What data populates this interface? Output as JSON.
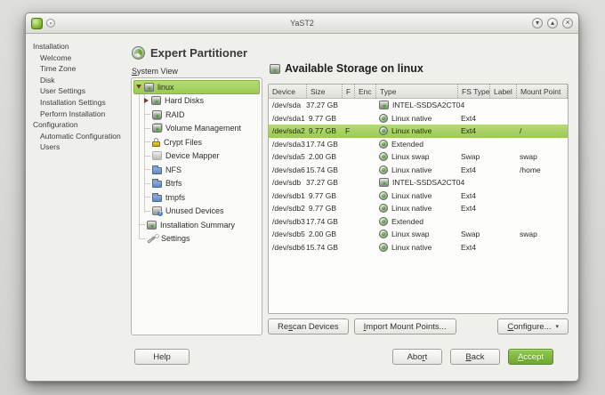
{
  "window": {
    "title": "YaST2",
    "controls": {
      "minimize": "minimize",
      "maximize": "maximize",
      "close": "close"
    }
  },
  "sidebar": {
    "items": [
      {
        "label": "Installation",
        "level": 0
      },
      {
        "label": "Welcome",
        "level": 1
      },
      {
        "label": "Time Zone",
        "level": 1
      },
      {
        "label": "Disk",
        "level": 1
      },
      {
        "label": "User Settings",
        "level": 1
      },
      {
        "label": "Installation Settings",
        "level": 1
      },
      {
        "label": "Perform Installation",
        "level": 1
      },
      {
        "label": "Configuration",
        "level": 0
      },
      {
        "label": "Automatic Configuration",
        "level": 1
      },
      {
        "label": "Users",
        "level": 1
      }
    ]
  },
  "main": {
    "title": "Expert Partitioner",
    "system_view": {
      "label": {
        "pre": "",
        "key": "S",
        "post": "ystem View"
      },
      "tree": [
        {
          "label": "linux",
          "icon": "hdd",
          "level": 0,
          "expander": "open",
          "selected": true
        },
        {
          "label": "Hard Disks",
          "icon": "hdd",
          "level": 1,
          "expander": "closed"
        },
        {
          "label": "RAID",
          "icon": "raid",
          "level": 1
        },
        {
          "label": "Volume Management",
          "icon": "volume",
          "level": 1
        },
        {
          "label": "Crypt Files",
          "icon": "lock",
          "level": 1
        },
        {
          "label": "Device Mapper",
          "icon": "mapper",
          "level": 1
        },
        {
          "label": "NFS",
          "icon": "folder",
          "level": 1
        },
        {
          "label": "Btrfs",
          "icon": "folder",
          "level": 1
        },
        {
          "label": "tmpfs",
          "icon": "folder",
          "level": 1
        },
        {
          "label": "Unused Devices",
          "icon": "unused",
          "level": 1
        },
        {
          "label": "Installation Summary",
          "icon": "summary",
          "level": 0.5
        },
        {
          "label": "Settings",
          "icon": "wand",
          "level": 0.5
        }
      ]
    },
    "storage": {
      "title": "Available Storage on linux",
      "table": {
        "columns": [
          "Device",
          "Size",
          "F",
          "Enc",
          "Type",
          "FS Type",
          "Label",
          "Mount Point"
        ],
        "rows": [
          {
            "device": "/dev/sda",
            "size": "37.27 GB",
            "f": "",
            "enc": "",
            "type": "INTEL-SSDSA2CT04",
            "icon": "hdd",
            "fs_type": "",
            "label": "",
            "mount": "",
            "selected": false
          },
          {
            "device": "/dev/sda1",
            "size": "9.77 GB",
            "f": "",
            "enc": "",
            "type": "Linux native",
            "icon": "partition",
            "fs_type": "Ext4",
            "label": "",
            "mount": "",
            "selected": false
          },
          {
            "device": "/dev/sda2",
            "size": "9.77 GB",
            "f": "F",
            "enc": "",
            "type": "Linux native",
            "icon": "partition",
            "fs_type": "Ext4",
            "label": "",
            "mount": "/",
            "selected": true
          },
          {
            "device": "/dev/sda3",
            "size": "17.74 GB",
            "f": "",
            "enc": "",
            "type": "Extended",
            "icon": "partition",
            "fs_type": "",
            "label": "",
            "mount": "",
            "selected": false
          },
          {
            "device": "/dev/sda5",
            "size": "2.00 GB",
            "f": "",
            "enc": "",
            "type": "Linux swap",
            "icon": "partition",
            "fs_type": "Swap",
            "label": "",
            "mount": "swap",
            "selected": false
          },
          {
            "device": "/dev/sda6",
            "size": "15.74 GB",
            "f": "",
            "enc": "",
            "type": "Linux native",
            "icon": "partition",
            "fs_type": "Ext4",
            "label": "",
            "mount": "/home",
            "selected": false
          },
          {
            "device": "/dev/sdb",
            "size": "37.27 GB",
            "f": "",
            "enc": "",
            "type": "INTEL-SSDSA2CT04",
            "icon": "hdd",
            "fs_type": "",
            "label": "",
            "mount": "",
            "selected": false
          },
          {
            "device": "/dev/sdb1",
            "size": "9.77 GB",
            "f": "",
            "enc": "",
            "type": "Linux native",
            "icon": "partition",
            "fs_type": "Ext4",
            "label": "",
            "mount": "",
            "selected": false
          },
          {
            "device": "/dev/sdb2",
            "size": "9.77 GB",
            "f": "",
            "enc": "",
            "type": "Linux native",
            "icon": "partition",
            "fs_type": "Ext4",
            "label": "",
            "mount": "",
            "selected": false
          },
          {
            "device": "/dev/sdb3",
            "size": "17.74 GB",
            "f": "",
            "enc": "",
            "type": "Extended",
            "icon": "partition",
            "fs_type": "",
            "label": "",
            "mount": "",
            "selected": false
          },
          {
            "device": "/dev/sdb5",
            "size": "2.00 GB",
            "f": "",
            "enc": "",
            "type": "Linux swap",
            "icon": "partition",
            "fs_type": "Swap",
            "label": "",
            "mount": "swap",
            "selected": false
          },
          {
            "device": "/dev/sdb6",
            "size": "15.74 GB",
            "f": "",
            "enc": "",
            "type": "Linux native",
            "icon": "partition",
            "fs_type": "Ext4",
            "label": "",
            "mount": "",
            "selected": false
          }
        ]
      },
      "buttons": {
        "rescan": {
          "pre": "Re",
          "key": "s",
          "post": "can Devices"
        },
        "import": {
          "pre": "",
          "key": "I",
          "post": "mport Mount Points..."
        },
        "configure": {
          "pre": "",
          "key": "C",
          "post": "onfigure...",
          "arrow": "▾"
        }
      }
    }
  },
  "footer": {
    "help": "Help",
    "abort": {
      "pre": "Abo",
      "key": "r",
      "post": "t"
    },
    "back": {
      "pre": "",
      "key": "B",
      "post": "ack"
    },
    "accept": {
      "pre": "",
      "key": "A",
      "post": "ccept"
    }
  },
  "colors": {
    "selection_green": "#a8d164",
    "accept_green": "#79b22e",
    "window_bg": "#eff0ec",
    "titlebar_gradient_top": "#f7f7f5",
    "titlebar_gradient_bottom": "#dcdcd7"
  }
}
